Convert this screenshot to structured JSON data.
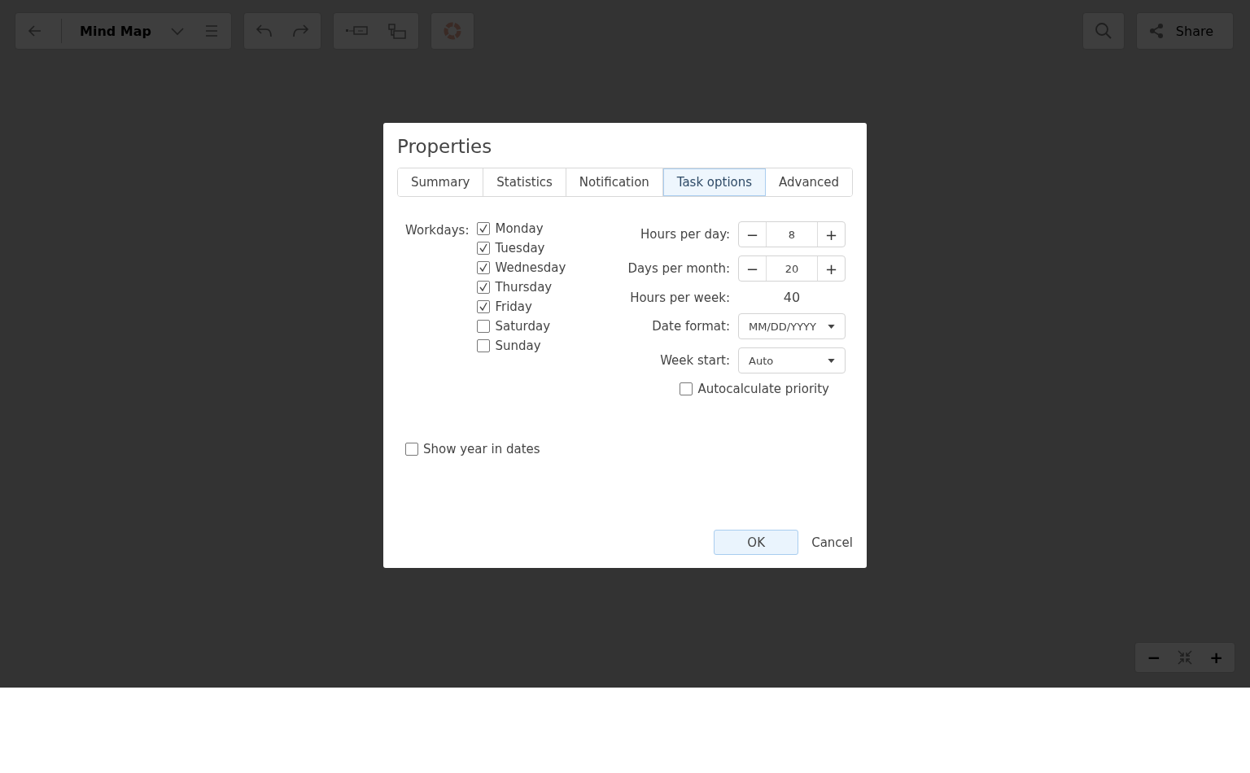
{
  "toolbar": {
    "title": "Mind Map",
    "share": "Share"
  },
  "zoom_controls": {
    "minus": "−",
    "plus": "+"
  },
  "dialog": {
    "title": "Properties",
    "tabs": [
      {
        "label": "Summary",
        "selected": false
      },
      {
        "label": "Statistics",
        "selected": false
      },
      {
        "label": "Notification",
        "selected": false
      },
      {
        "label": "Task options",
        "selected": true
      },
      {
        "label": "Advanced",
        "selected": false
      }
    ],
    "workdays_label": "Workdays:",
    "workdays": [
      {
        "label": "Monday",
        "checked": true
      },
      {
        "label": "Tuesday",
        "checked": true
      },
      {
        "label": "Wednesday",
        "checked": true
      },
      {
        "label": "Thursday",
        "checked": true
      },
      {
        "label": "Friday",
        "checked": true
      },
      {
        "label": "Saturday",
        "checked": false
      },
      {
        "label": "Sunday",
        "checked": false
      }
    ],
    "fields": [
      {
        "kind": "stepper",
        "label": "Hours per day:",
        "value": "8",
        "minus": "−",
        "plus": "+"
      },
      {
        "kind": "stepper",
        "label": "Days per month:",
        "value": "20",
        "minus": "−",
        "plus": "+"
      },
      {
        "kind": "readonly",
        "label": "Hours per week:",
        "value": "40"
      },
      {
        "kind": "dropdown",
        "label": "Date format:",
        "value": "MM/DD/YYYY"
      },
      {
        "kind": "dropdown",
        "label": "Week start:",
        "value": "Auto"
      }
    ],
    "autocalculate": {
      "label": "Autocalculate priority",
      "checked": false
    },
    "show_year": {
      "label": "Show year in dates",
      "checked": false
    },
    "ok": "OK",
    "cancel": "Cancel"
  }
}
